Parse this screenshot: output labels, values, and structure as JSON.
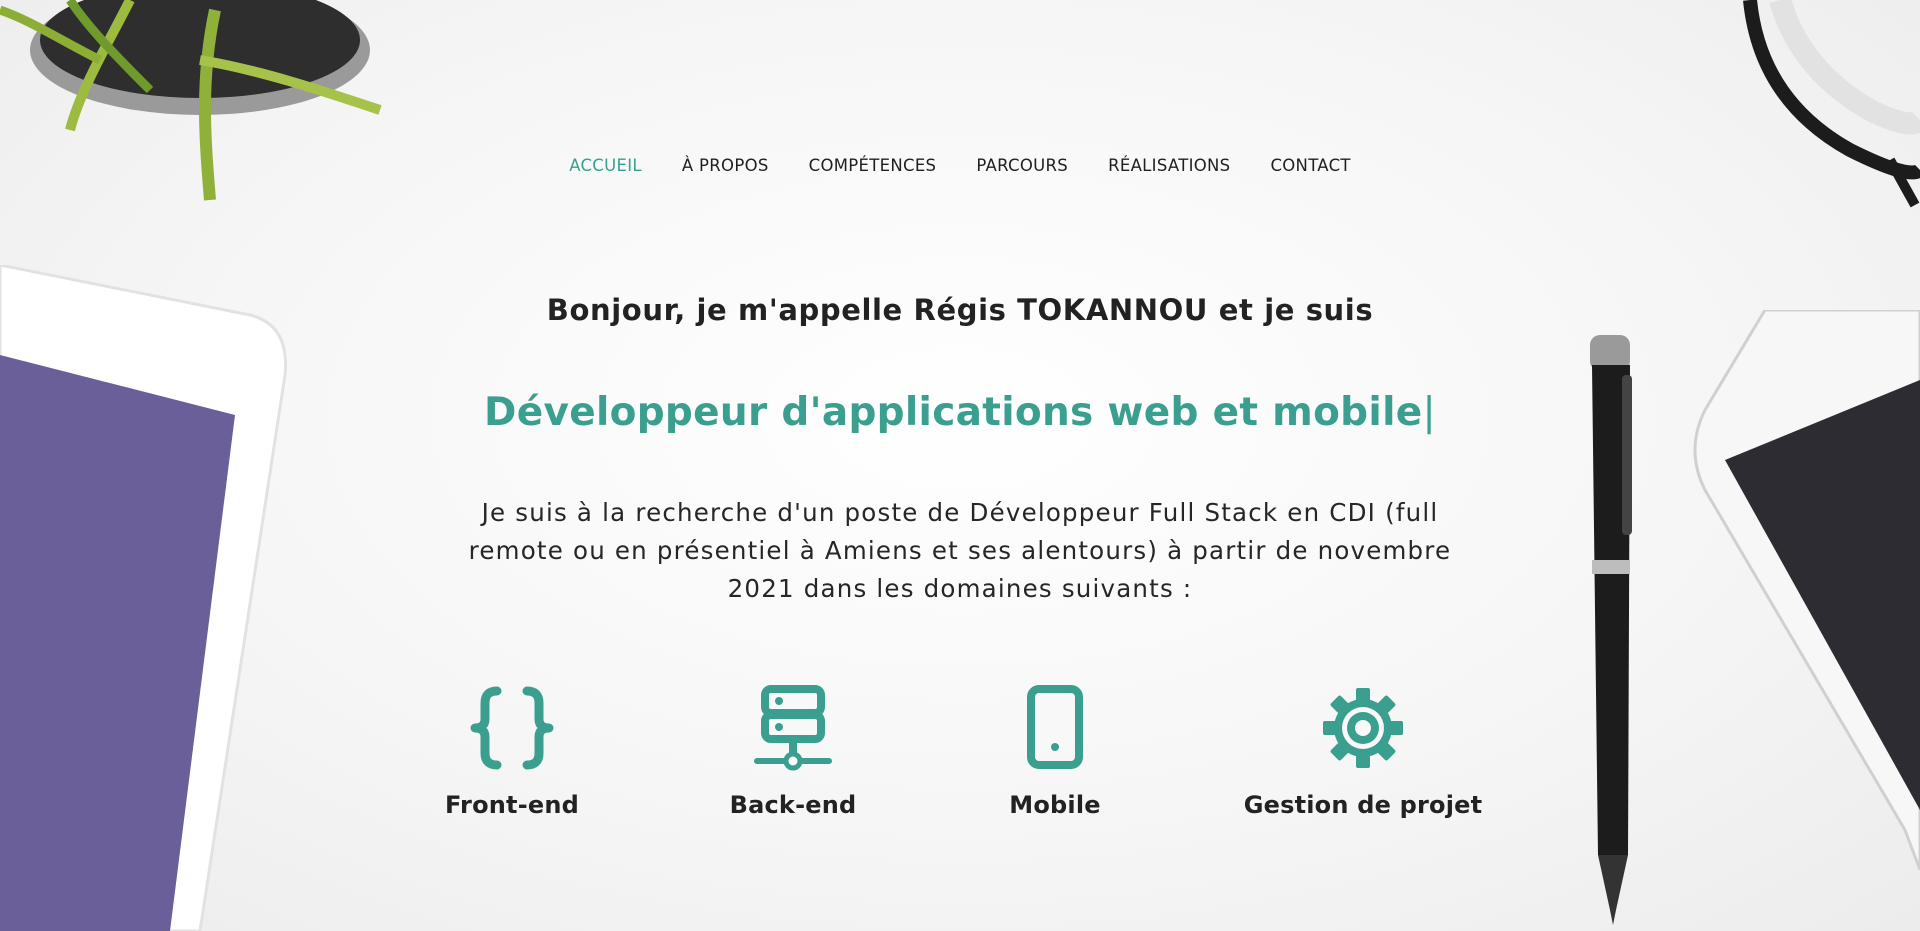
{
  "nav": {
    "items": [
      {
        "label": "ACCUEIL",
        "active": true
      },
      {
        "label": "À PROPOS",
        "active": false
      },
      {
        "label": "COMPÉTENCES",
        "active": false
      },
      {
        "label": "PARCOURS",
        "active": false
      },
      {
        "label": "RÉALISATIONS",
        "active": false
      },
      {
        "label": "CONTACT",
        "active": false
      }
    ]
  },
  "hero": {
    "greeting": "Bonjour, je m'appelle Régis TOKANNOU et je suis",
    "role": "Développeur d'applications web et mobile",
    "caret": "|",
    "intro_line1": "Je suis à la recherche d'un poste de Développeur Full Stack en CDI (full",
    "intro_line2": "remote ou en présentiel à Amiens et ses alentours) à partir de novembre",
    "intro_line3": "2021 dans les domaines suivants :"
  },
  "skills": [
    {
      "label": "Front-end",
      "icon": "code-braces-icon"
    },
    {
      "label": "Back-end",
      "icon": "server-icon"
    },
    {
      "label": "Mobile",
      "icon": "mobile-phone-icon"
    },
    {
      "label": "Gestion de projet",
      "icon": "gear-icon"
    }
  ],
  "colors": {
    "accent": "#3a9f8f",
    "text": "#262626",
    "background": "#f4f4f4"
  }
}
